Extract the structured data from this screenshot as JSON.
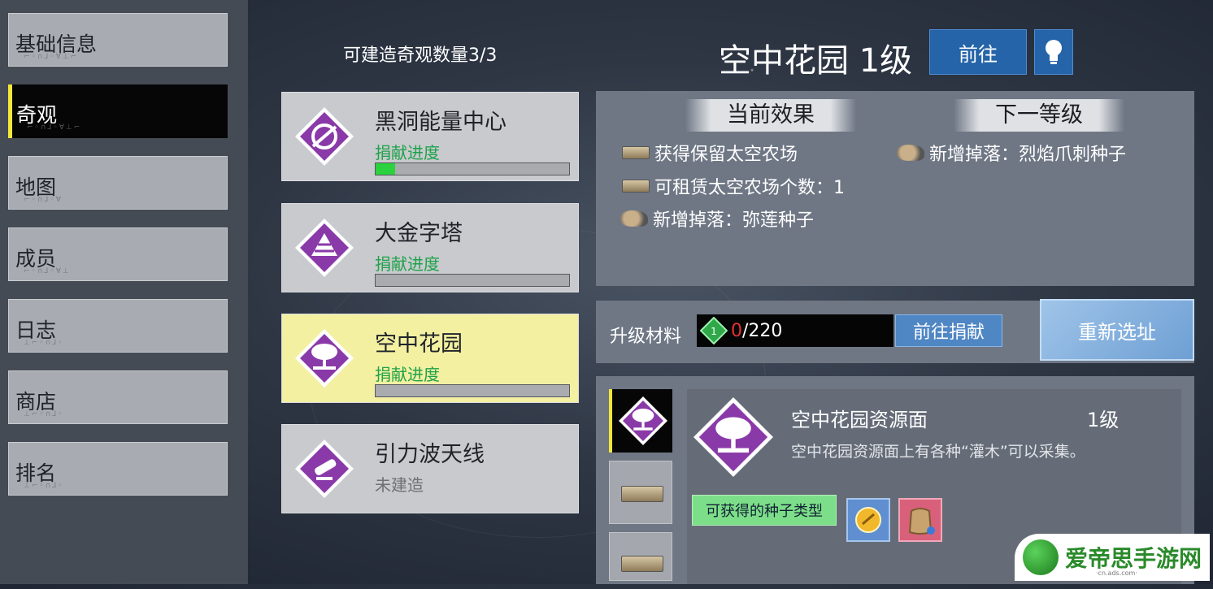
{
  "sidebar": {
    "items": [
      {
        "label": "基础信息",
        "active": false
      },
      {
        "label": "奇观",
        "active": true
      },
      {
        "label": "地图",
        "active": false
      },
      {
        "label": "成员",
        "active": false
      },
      {
        "label": "日志",
        "active": false
      },
      {
        "label": "商店",
        "active": false
      },
      {
        "label": "排名",
        "active": false
      }
    ]
  },
  "wonder_list": {
    "count_label": "可建造奇观数量3/3",
    "cards": [
      {
        "name": "黑洞能量中心",
        "status": "捐献进度",
        "progress": 0.1,
        "icon": "blackhole-icon"
      },
      {
        "name": "大金字塔",
        "status": "捐献进度",
        "progress": 0,
        "icon": "pyramid-icon"
      },
      {
        "name": "空中花园",
        "status": "捐献进度",
        "progress": 0,
        "icon": "tree-icon",
        "selected": true
      },
      {
        "name": "引力波天线",
        "status": "未建造",
        "icon": "antenna-icon"
      }
    ]
  },
  "header": {
    "title": "空中花园 1级",
    "goto_label": "前往",
    "hint_icon": "lightbulb-icon"
  },
  "effects": {
    "current_header": "当前效果",
    "next_header": "下一等级",
    "current": [
      {
        "icon": "platform-icon",
        "text": "获得保留太空农场"
      },
      {
        "icon": "platform-icon",
        "text": "可租赁太空农场个数：1"
      },
      {
        "icon": "creature-icon",
        "text": "新增掉落：弥莲种子"
      }
    ],
    "next": [
      {
        "icon": "creature-icon",
        "text": "新增掉落：烈焰爪刺种子"
      }
    ]
  },
  "upgrade": {
    "label": "升级材料",
    "material_icon": "green-gem-icon",
    "have": "0",
    "need": "/220",
    "donate_label": "前往捐献",
    "relocate_label": "重新选址"
  },
  "resource": {
    "name": "空中花园资源面",
    "level": "1级",
    "description": "空中花园资源面上有各种“灌木”可以采集。",
    "seed_tag": "可获得的种子类型",
    "seeds": [
      {
        "icon": "gold-seed-icon"
      },
      {
        "icon": "sack-icon"
      }
    ]
  },
  "watermark": {
    "text": "爱帝思手游网",
    "sub": "·cn.ads.com·"
  },
  "colors": {
    "accent_yellow": "#f2e73a",
    "progress_green": "#2bd13f",
    "button_blue": "#2564a8",
    "selected_card": "#f3f0a2"
  }
}
